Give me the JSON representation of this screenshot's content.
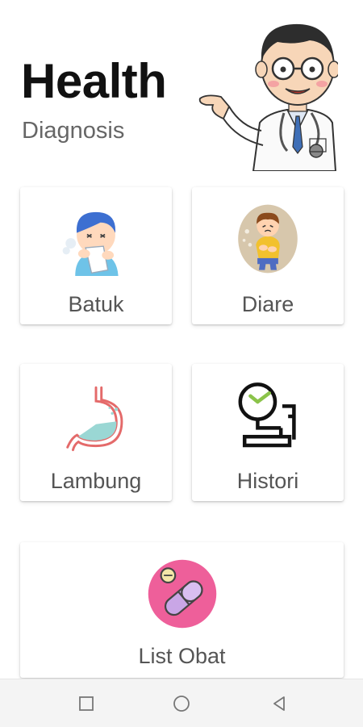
{
  "header": {
    "title": "Health",
    "subtitle": "Diagnosis",
    "illustration": "doctor-illustration"
  },
  "menu": [
    {
      "label": "Batuk",
      "icon": "coughing-person-icon"
    },
    {
      "label": "Diare",
      "icon": "stomachache-child-icon"
    },
    {
      "label": "Lambung",
      "icon": "stomach-icon"
    },
    {
      "label": "Histori",
      "icon": "clock-stand-icon"
    },
    {
      "label": "List Obat",
      "icon": "pill-icon"
    }
  ],
  "navbar": {
    "buttons": [
      "recent-apps-icon",
      "home-icon",
      "back-icon"
    ]
  },
  "colors": {
    "background": "#ffffff",
    "title": "#111111",
    "subtitle": "#666666",
    "label": "#555555",
    "pill_circle": "#ee5f9a",
    "pill_body": "#c9a6e6",
    "stomach": "#9ad7d4",
    "navbar": "#f4f4f4"
  }
}
